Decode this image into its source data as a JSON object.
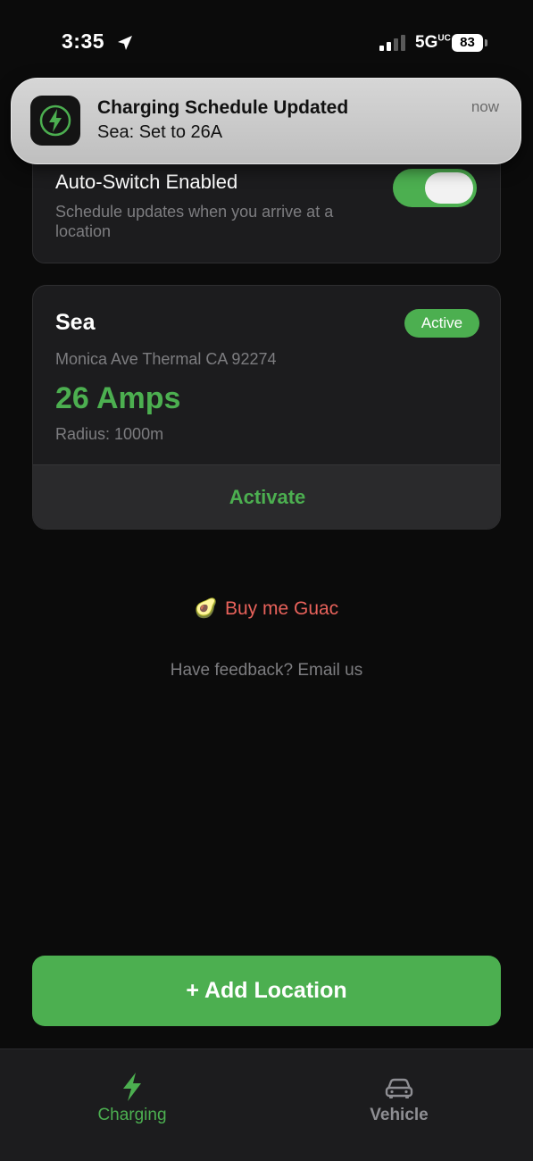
{
  "status_bar": {
    "time": "3:35",
    "network": "5G",
    "network_suffix": "UC",
    "battery": "83"
  },
  "notification": {
    "title": "Charging Schedule Updated",
    "body": "Sea: Set to 26A",
    "time": "now",
    "icon": "lightning-bolt-icon"
  },
  "auto_switch": {
    "title": "Auto-Switch Enabled",
    "description": "Schedule updates when you arrive at a location",
    "enabled": true
  },
  "location": {
    "name": "Sea",
    "badge": "Active",
    "address": "Monica Ave Thermal CA 92274",
    "amps": "26 Amps",
    "radius": "Radius: 1000m",
    "action": "Activate"
  },
  "links": {
    "guac": "Buy me Guac",
    "guac_emoji": "🥑",
    "feedback": "Have feedback? Email us"
  },
  "add_button": "+ Add Location",
  "tabs": [
    {
      "label": "Charging",
      "icon": "lightning-bolt-icon",
      "active": true
    },
    {
      "label": "Vehicle",
      "icon": "car-icon",
      "active": false
    }
  ],
  "colors": {
    "accent": "#4caf50",
    "background": "#0b0b0b",
    "card": "#1c1c1e",
    "link_red": "#e8625b",
    "muted": "#7d7d80"
  }
}
